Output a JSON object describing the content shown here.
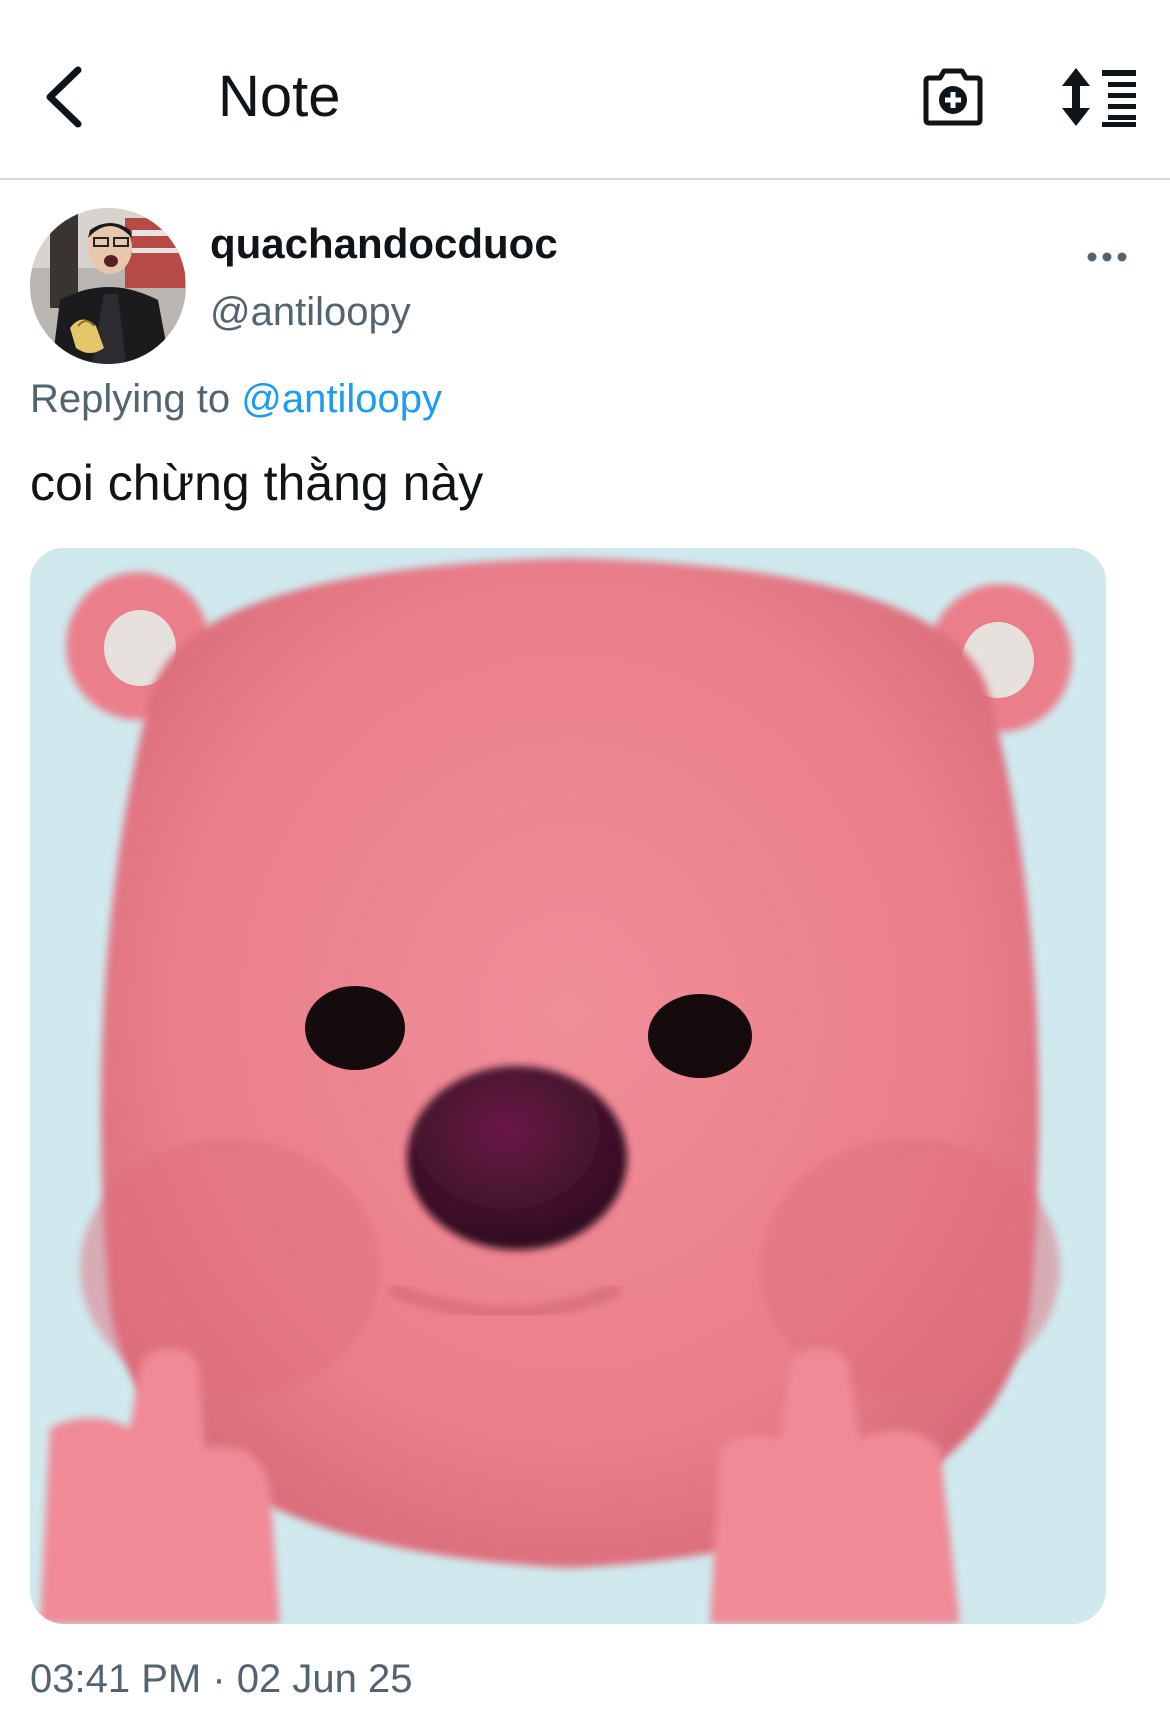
{
  "header": {
    "title": "Note",
    "icons": [
      "back-icon",
      "camera-add-icon",
      "sort-lines-icon"
    ]
  },
  "tweet": {
    "display_name": "quachandocduoc",
    "handle": "@antiloopy",
    "replying_prefix": "Replying to",
    "replying_to": "@antiloopy",
    "text": "coi chừng thằng này",
    "time": "03:41 PM",
    "separator": "·",
    "date": "02 Jun 25"
  },
  "colors": {
    "accent": "#1d9bf0",
    "secondary_text": "#536471",
    "primary_text": "#0f1419"
  }
}
